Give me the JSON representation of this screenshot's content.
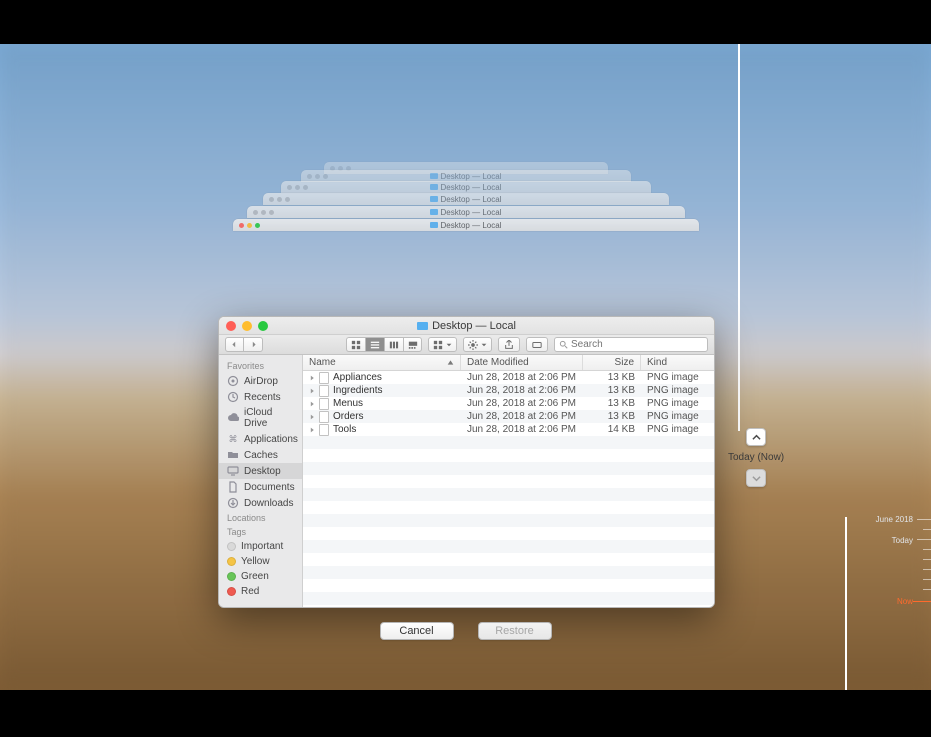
{
  "window": {
    "title_prefix": "Desktop",
    "title_suffix": "— Local"
  },
  "ghost_title": "Desktop — Local",
  "toolbar": {
    "search_placeholder": "Search"
  },
  "sidebar": {
    "favorites_heading": "Favorites",
    "locations_heading": "Locations",
    "tags_heading": "Tags",
    "favorites": [
      {
        "label": "AirDrop",
        "icon": "airdrop"
      },
      {
        "label": "Recents",
        "icon": "clock"
      },
      {
        "label": "iCloud Drive",
        "icon": "cloud"
      },
      {
        "label": "Applications",
        "icon": "apps"
      },
      {
        "label": "Caches",
        "icon": "folder"
      },
      {
        "label": "Desktop",
        "icon": "desktop",
        "selected": true
      },
      {
        "label": "Documents",
        "icon": "doc"
      },
      {
        "label": "Downloads",
        "icon": "download"
      }
    ],
    "tags": [
      {
        "label": "Important",
        "color": "#d9d9d9"
      },
      {
        "label": "Yellow",
        "color": "#f5c445"
      },
      {
        "label": "Green",
        "color": "#68c558"
      },
      {
        "label": "Red",
        "color": "#ef5a50"
      }
    ]
  },
  "columns": {
    "name": "Name",
    "date": "Date Modified",
    "size": "Size",
    "kind": "Kind"
  },
  "files": [
    {
      "name": "Appliances",
      "date": "Jun 28, 2018 at 2:06 PM",
      "size": "13 KB",
      "kind": "PNG image"
    },
    {
      "name": "Ingredients",
      "date": "Jun 28, 2018 at 2:06 PM",
      "size": "13 KB",
      "kind": "PNG image"
    },
    {
      "name": "Menus",
      "date": "Jun 28, 2018 at 2:06 PM",
      "size": "13 KB",
      "kind": "PNG image"
    },
    {
      "name": "Orders",
      "date": "Jun 28, 2018 at 2:06 PM",
      "size": "13 KB",
      "kind": "PNG image"
    },
    {
      "name": "Tools",
      "date": "Jun 28, 2018 at 2:06 PM",
      "size": "14 KB",
      "kind": "PNG image"
    }
  ],
  "buttons": {
    "cancel": "Cancel",
    "restore": "Restore"
  },
  "time_nav": {
    "label": "Today (Now)"
  },
  "timeline": {
    "top": "June 2018",
    "mid": "Today",
    "now": "Now"
  }
}
